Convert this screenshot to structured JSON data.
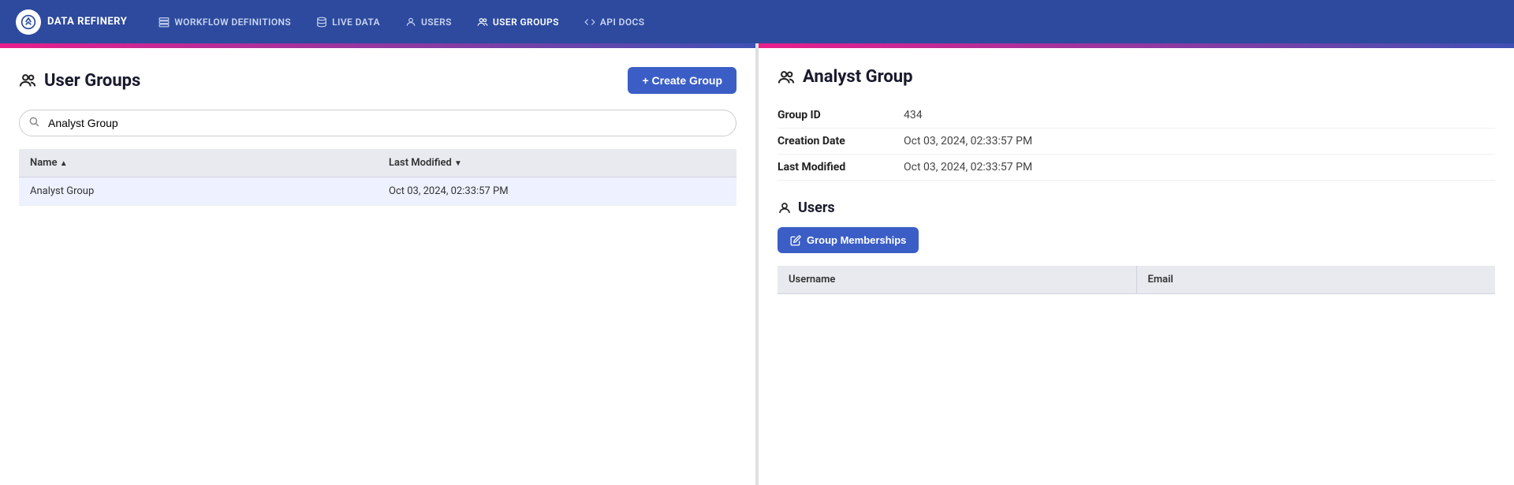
{
  "nav": {
    "brand": "DATA REFINERY",
    "items": [
      {
        "id": "workflow-definitions",
        "label": "WORKFLOW DEFINITIONS",
        "icon": "layers-icon"
      },
      {
        "id": "live-data",
        "label": "LIVE DATA",
        "icon": "database-icon"
      },
      {
        "id": "users",
        "label": "USERS",
        "icon": "user-icon"
      },
      {
        "id": "user-groups",
        "label": "USER GROUPS",
        "icon": "users-icon",
        "active": true
      },
      {
        "id": "api-docs",
        "label": "API DOCS",
        "icon": "code-icon"
      }
    ]
  },
  "left_panel": {
    "title": "User Groups",
    "create_button_label": "+ Create Group",
    "search": {
      "placeholder": "Analyst Group",
      "value": "Analyst Group"
    },
    "table": {
      "columns": [
        {
          "id": "name",
          "label": "Name",
          "sort": "asc"
        },
        {
          "id": "last_modified",
          "label": "Last Modified",
          "sort": "desc"
        }
      ],
      "rows": [
        {
          "name": "Analyst Group",
          "last_modified": "Oct 03, 2024, 02:33:57 PM",
          "selected": true
        }
      ]
    }
  },
  "right_panel": {
    "title": "Analyst Group",
    "details": {
      "group_id_label": "Group ID",
      "group_id_value": "434",
      "creation_date_label": "Creation Date",
      "creation_date_value": "Oct 03, 2024, 02:33:57 PM",
      "last_modified_label": "Last Modified",
      "last_modified_value": "Oct 03, 2024, 02:33:57 PM"
    },
    "users_section": {
      "heading": "Users",
      "group_memberships_button": "Group Memberships",
      "table": {
        "columns": [
          {
            "id": "username",
            "label": "Username"
          },
          {
            "id": "email",
            "label": "Email"
          }
        ],
        "rows": []
      }
    }
  }
}
